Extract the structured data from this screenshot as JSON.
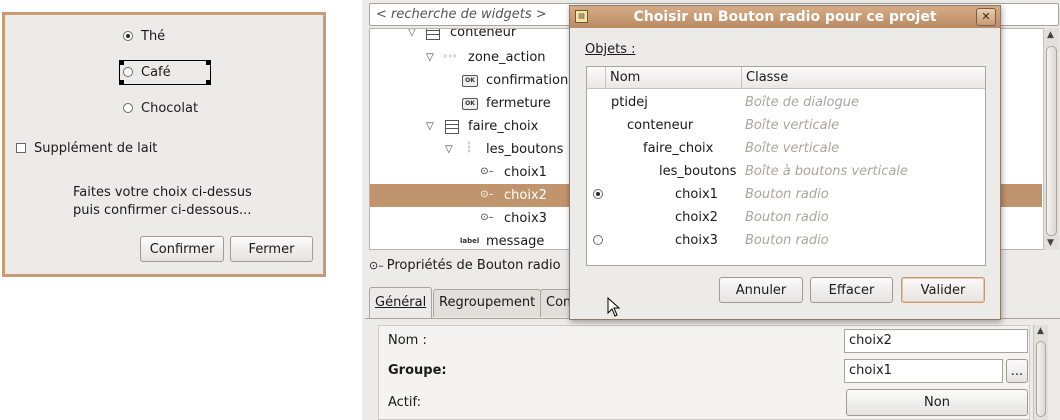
{
  "preview": {
    "options": [
      {
        "label": "Thé",
        "selected": true
      },
      {
        "label": "Café",
        "selected": false
      },
      {
        "label": "Chocolat",
        "selected": false
      }
    ],
    "checkbox_label": "Supplément de lait",
    "message_line1": "Faites votre choix ci-dessus",
    "message_line2": "puis confirmer ci-dessous...",
    "confirm_label": "Confirmer",
    "close_label": "Fermer"
  },
  "search": {
    "placeholder": "< recherche de widgets >"
  },
  "tree": {
    "rows": [
      {
        "label": "conteneur",
        "icon": "box-icon",
        "expanded": true
      },
      {
        "label": "zone_action",
        "icon": "hbox-dots-icon",
        "expanded": true
      },
      {
        "label": "confirmation",
        "icon": "button-icon"
      },
      {
        "label": "fermeture",
        "icon": "button-icon"
      },
      {
        "label": "faire_choix",
        "icon": "box-icon",
        "expanded": true
      },
      {
        "label": "les_boutons",
        "icon": "vbox-dots-icon",
        "expanded": true
      },
      {
        "label": "choix1",
        "icon": "radio-icon"
      },
      {
        "label": "choix2",
        "icon": "radio-icon",
        "selected": true
      },
      {
        "label": "choix3",
        "icon": "radio-icon"
      },
      {
        "label": "message",
        "icon": "label-icon"
      }
    ]
  },
  "props": {
    "title": "Propriétés de Bouton radio",
    "tabs": [
      "Général",
      "Regroupement",
      "Com"
    ],
    "name_label": "Nom :",
    "name_value": "choix2",
    "group_label": "Groupe:",
    "group_value": "choix1",
    "group_button": "...",
    "active_label": "Actif:",
    "active_value": "Non"
  },
  "dialog": {
    "title": "Choisir un Bouton radio pour ce projet",
    "close_glyph": "✕",
    "objects_label": "Objets :",
    "col_name": "Nom",
    "col_class": "Classe",
    "rows": [
      {
        "name": "ptidej",
        "class": "Boîte de dialogue",
        "indent": 0
      },
      {
        "name": "conteneur",
        "class": "Boîte verticale",
        "indent": 1
      },
      {
        "name": "faire_choix",
        "class": "Boîte verticale",
        "indent": 2
      },
      {
        "name": "les_boutons",
        "class": "Boîte à boutons verticale",
        "indent": 3
      },
      {
        "name": "choix1",
        "class": "Bouton radio",
        "indent": 4,
        "radio": "on"
      },
      {
        "name": "choix2",
        "class": "Bouton radio",
        "indent": 4,
        "radio": "none"
      },
      {
        "name": "choix3",
        "class": "Bouton radio",
        "indent": 4,
        "radio": "off"
      }
    ],
    "cancel_label": "Annuler",
    "clear_label": "Effacer",
    "ok_label": "Valider"
  },
  "label_icon_text": "label",
  "button_icon_text": "OK"
}
